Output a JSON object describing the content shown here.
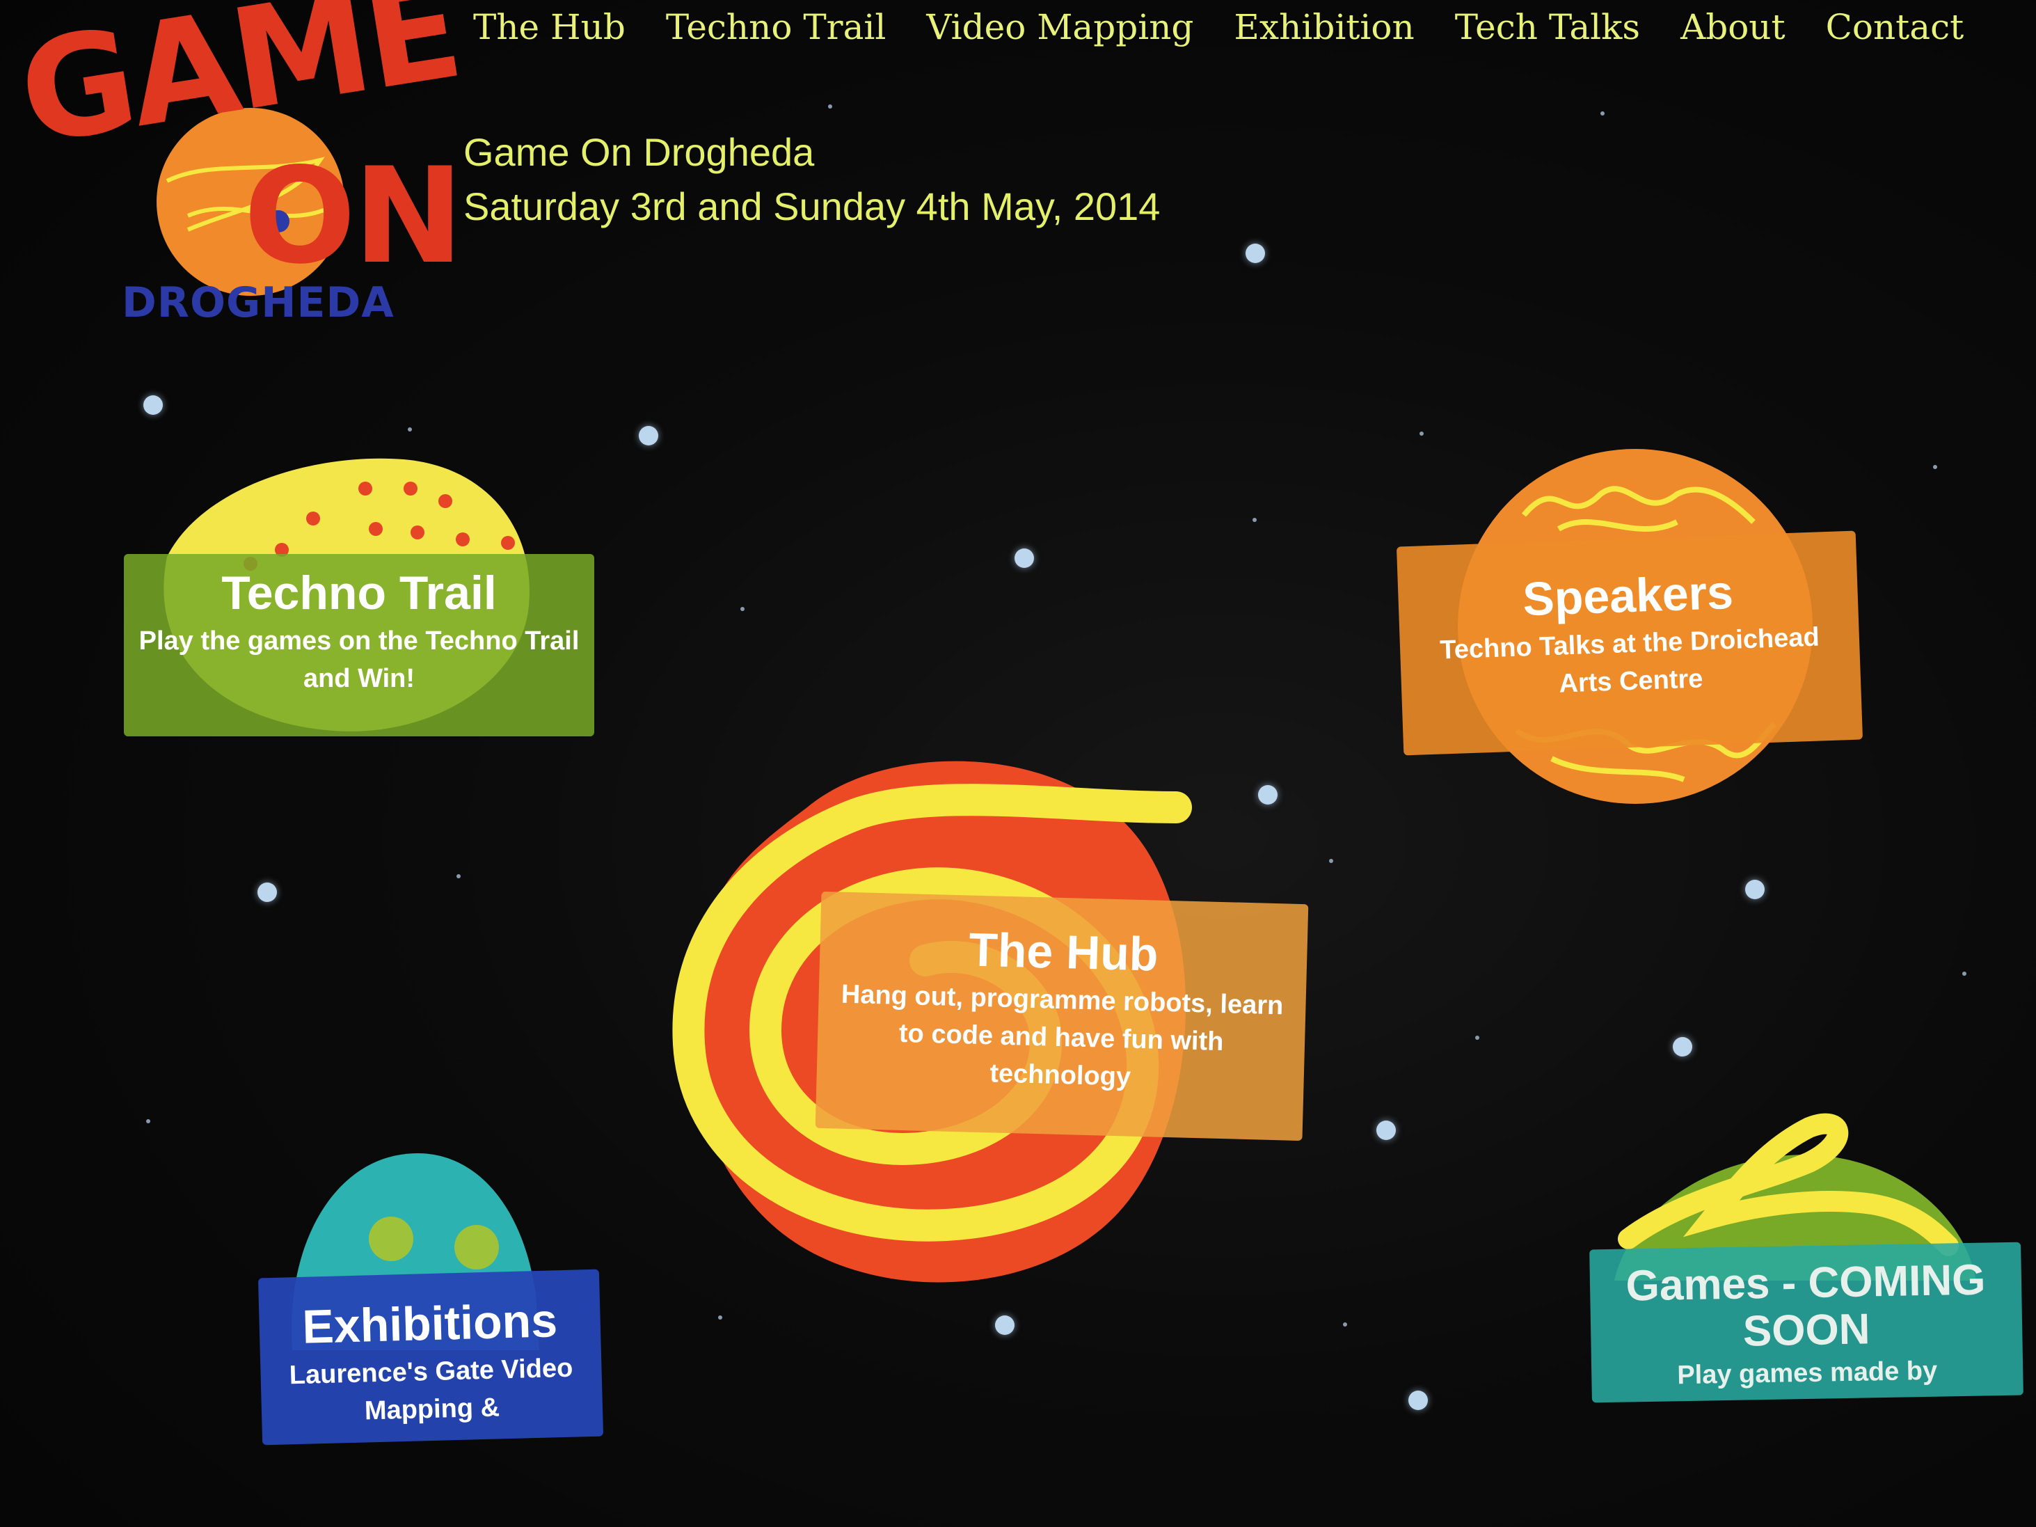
{
  "logo": {
    "game": "GAME",
    "on": "ON",
    "sub": "DROGHEDA"
  },
  "nav": {
    "items": [
      "The Hub",
      "Techno Trail",
      "Video Mapping",
      "Exhibition",
      "Tech Talks",
      "About",
      "Contact"
    ]
  },
  "header": {
    "line1": "Game On Drogheda",
    "line2": "Saturday 3rd and Sunday 4th May, 2014"
  },
  "cards": {
    "techno_trail": {
      "title": "Techno Trail",
      "desc": "Play the games on the Techno Trail and Win!"
    },
    "speakers": {
      "title": "Speakers",
      "desc": "Techno Talks at the Droichead Arts Centre"
    },
    "hub": {
      "title": "The Hub",
      "desc": "Hang out, programme robots, learn to code and have fun with technology"
    },
    "exhibitions": {
      "title": "Exhibitions",
      "desc": "Laurence's Gate Video Mapping &"
    },
    "games": {
      "title": "Games - COMING SOON",
      "desc": "Play games made by"
    }
  },
  "colors": {
    "background": "#050505",
    "nav_text": "#e8f27a",
    "logo_red": "#e03820",
    "logo_orange": "#f08a2a",
    "logo_blue": "#2c3aa8",
    "techno_green": "#78aa28",
    "speakers_orange": "#ec8c28",
    "hub_orange": "#f0a03c",
    "hub_planet_red": "#ec4a24",
    "hub_swirl_yellow": "#f6e840",
    "exhibitions_blue": "#2646b4",
    "games_teal": "#28aaa0"
  }
}
